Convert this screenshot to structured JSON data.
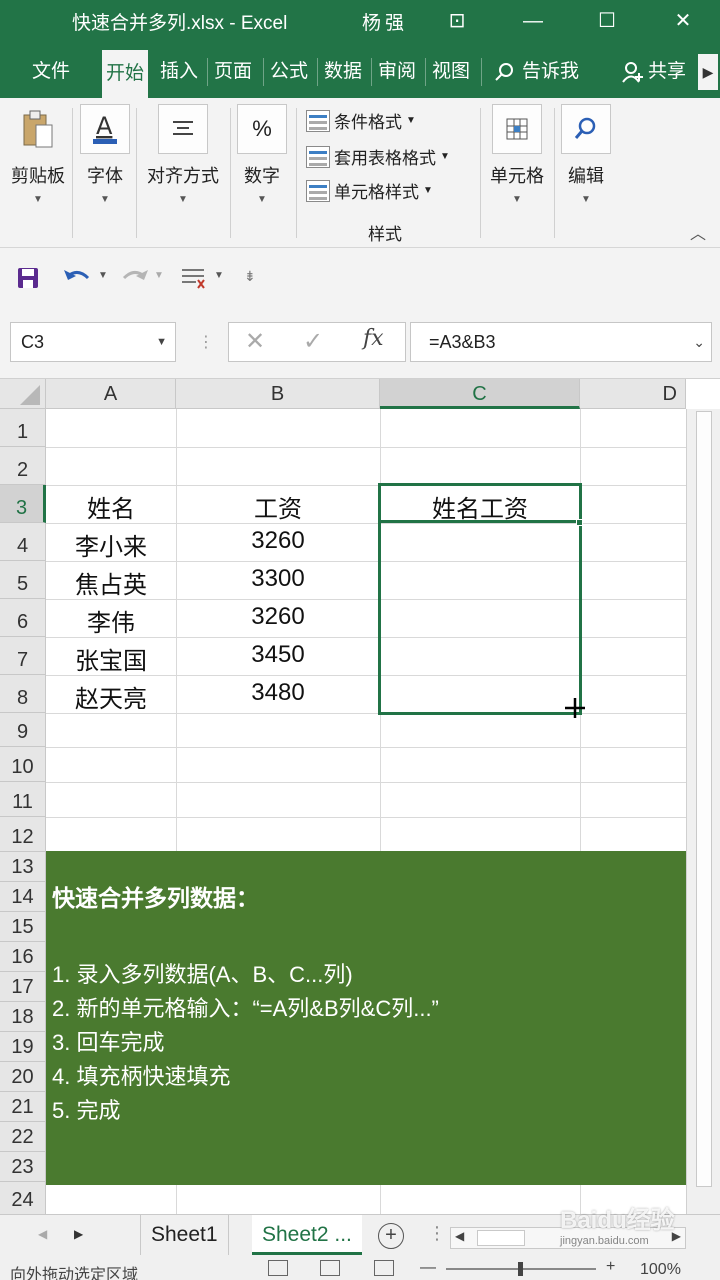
{
  "titlebar": {
    "title": "快速合并多列.xlsx  -  Excel",
    "user": "杨强",
    "controls": [
      "⊡",
      "—",
      "☐",
      "✕"
    ]
  },
  "tabs": [
    "文件",
    "开始",
    "插入",
    "页面",
    "公式",
    "数据",
    "审阅",
    "视图"
  ],
  "tell_me": "告诉我",
  "share": "共享",
  "ribbon": {
    "clipboard": "剪贴板",
    "font": "字体",
    "alignment": "对齐方式",
    "number": "数字",
    "number_icon": "%",
    "conditional_format": "条件格式",
    "format_as_table": "套用表格格式",
    "cell_styles": "单元格样式",
    "styles_group": "样式",
    "cells": "单元格",
    "editing": "编辑"
  },
  "formula_bar": {
    "name_box": "C3",
    "formula": "=A3&B3"
  },
  "columns": [
    "A",
    "B",
    "C",
    "D"
  ],
  "rows": [
    "1",
    "2",
    "3",
    "4",
    "5",
    "6",
    "7",
    "8",
    "9",
    "10",
    "11",
    "12",
    "13",
    "14",
    "15",
    "16",
    "17",
    "18",
    "19",
    "20",
    "21",
    "22",
    "23",
    "24"
  ],
  "cells": {
    "A3": "姓名",
    "B3": "工资",
    "C3": "姓名工资",
    "A4": "李小来",
    "B4": "3260",
    "A5": "焦占英",
    "B5": "3300",
    "A6": "李伟",
    "B6": "3260",
    "A7": "张宝国",
    "B7": "3450",
    "A8": "赵天亮",
    "B8": "3480"
  },
  "notes": {
    "title": "快速合并多列数据：",
    "lines": [
      "1. 录入多列数据(A、B、C...列)",
      "2. 新的单元格输入：“=A列&B列&C列...”",
      "3. 回车完成",
      "4. 填充柄快速填充",
      "5. 完成"
    ]
  },
  "sheets": [
    "Sheet1",
    "Sheet2 ..."
  ],
  "status": {
    "message": "向外拖动选定区域",
    "zoom": "100%"
  },
  "watermark": {
    "brand": "Baidu经验",
    "url": "jingyan.baidu.com"
  },
  "colors": {
    "excel_green": "#227447",
    "notes_bg": "#4a7a2f",
    "selection": "#217346"
  }
}
